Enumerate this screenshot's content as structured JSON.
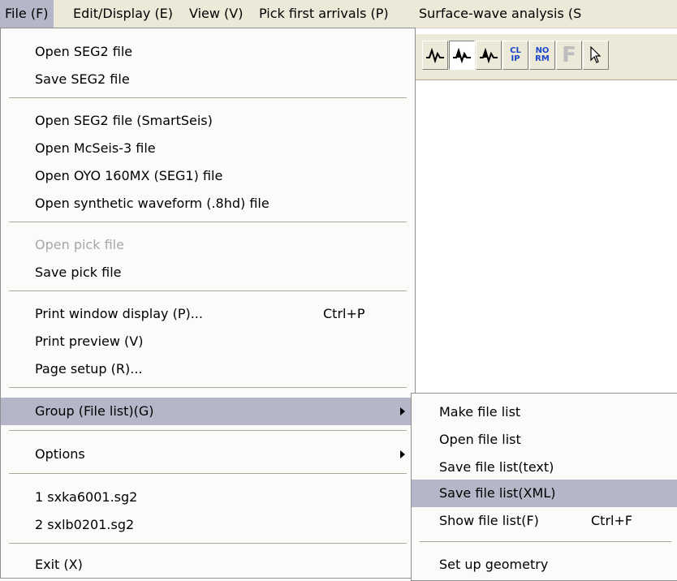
{
  "menubar": {
    "items": [
      {
        "label": "File (F)"
      },
      {
        "label": "Edit/Display (E)"
      },
      {
        "label": "View (V)"
      },
      {
        "label": "Pick first arrivals (P)"
      },
      {
        "label": "Surface-wave analysis (S"
      }
    ]
  },
  "toolbar": {
    "clip_text": "CL IP",
    "norm_text": "NO RM",
    "f_text": "F",
    "buttons": [
      "wiggle-icon",
      "variable-area-icon",
      "wiggle-fill-icon",
      "clip-icon",
      "normalize-icon",
      "f-icon",
      "pointer-icon"
    ]
  },
  "file_menu": {
    "items": [
      {
        "label": "Open SEG2 file"
      },
      {
        "label": "Save SEG2 file"
      },
      {
        "label": "Open SEG2 file (SmartSeis)"
      },
      {
        "label": "Open McSeis-3 file"
      },
      {
        "label": "Open OYO 160MX (SEG1) file"
      },
      {
        "label": "Open synthetic waveform (.8hd) file"
      },
      {
        "label": "Open pick file"
      },
      {
        "label": "Save pick file"
      },
      {
        "label": "Print window display (P)...",
        "shortcut": "Ctrl+P"
      },
      {
        "label": "Print preview (V)"
      },
      {
        "label": "Page setup (R)..."
      },
      {
        "label": "Group (File list)(G)"
      },
      {
        "label": "Options"
      },
      {
        "label": "1 sxka6001.sg2"
      },
      {
        "label": "2 sxlb0201.sg2"
      },
      {
        "label": "Exit (X)"
      }
    ]
  },
  "group_submenu": {
    "items": [
      {
        "label": "Make file list"
      },
      {
        "label": "Open file list"
      },
      {
        "label": "Save file list(text)"
      },
      {
        "label": "Save file list(XML)"
      },
      {
        "label": "Show file list(F)",
        "shortcut": "Ctrl+F"
      },
      {
        "label": "Set up geometry"
      }
    ]
  },
  "colors": {
    "highlight": "#b5b6c8",
    "menu_bg": "#fbfbf9",
    "disabled_text": "#a7a6aa",
    "toolbar_bg": "#ece9d8",
    "icon_blue": "#1a47c8"
  }
}
